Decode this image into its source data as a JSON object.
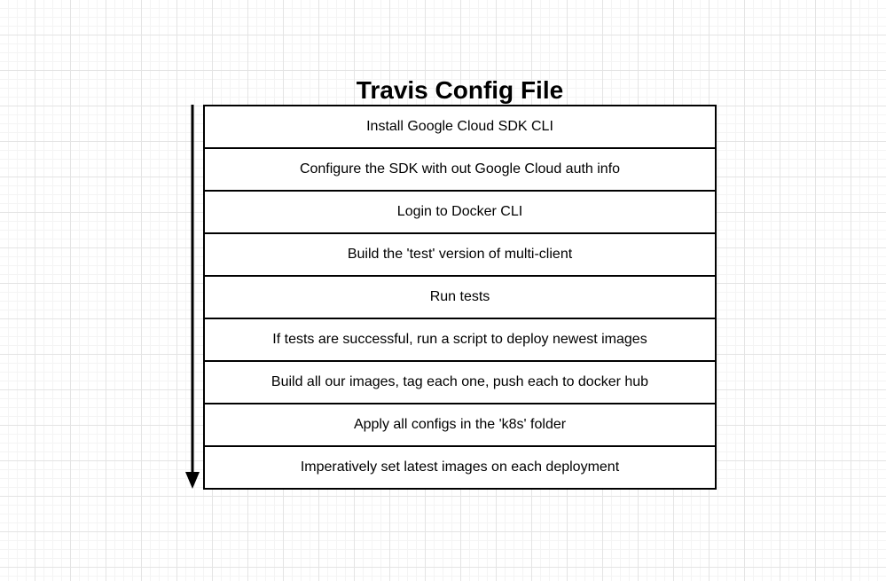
{
  "diagram": {
    "title": "Travis Config File",
    "steps": [
      "Install Google Cloud SDK CLI",
      "Configure the SDK with out Google Cloud auth info",
      "Login to Docker CLI",
      "Build the 'test' version of multi-client",
      "Run tests",
      "If tests are successful, run a script to deploy newest images",
      "Build all our images, tag each one, push each to docker hub",
      "Apply all configs in the 'k8s' folder",
      "Imperatively set latest images on each deployment"
    ]
  }
}
